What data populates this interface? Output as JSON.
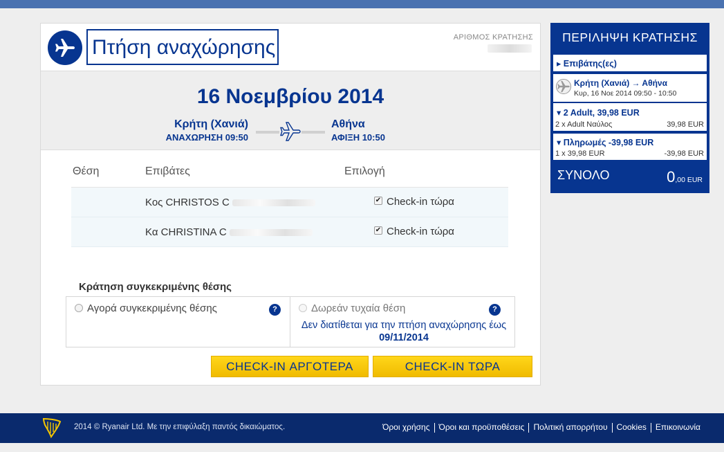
{
  "header": {
    "title": "Πτήση αναχώρησης",
    "booking_label": "ΑΡΙΘΜΟΣ ΚΡΑΤΗΣΗΣ"
  },
  "flight": {
    "date": "16 Νοεμβρίου 2014",
    "origin": {
      "name": "Κρήτη (Χανιά)",
      "time_label": "ΑΝΑΧΩΡΗΣΗ 09:50"
    },
    "destination": {
      "name": "Αθήνα",
      "time_label": "ΑΦΙΞΗ 10:50"
    }
  },
  "passengers": {
    "columns": {
      "seat": "Θέση",
      "passengers": "Επιβάτες",
      "choice": "Επιλογή"
    },
    "rows": [
      {
        "name": "Κος CHRISTOS C",
        "checked": true,
        "check_label": "Check-in τώρα"
      },
      {
        "name": "Κα CHRISTINA C",
        "checked": true,
        "check_label": "Check-in τώρα"
      }
    ]
  },
  "seat_booking": {
    "title": "Κράτηση συγκεκριμένης θέσης",
    "option_buy": "Αγορά συγκεκριμένης θέσης",
    "option_free": "Δωρεάν τυχαία θέση",
    "help": "?",
    "unavailable_note": "Δεν διατίθεται για την πτήση αναχώρησης έως",
    "unavailable_date": "09/11/2014"
  },
  "buttons": {
    "later": "CHECK-IN ΑΡΓΟΤΕΡΑ",
    "now": "CHECK-IN ΤΩΡΑ"
  },
  "summary": {
    "title": "ΠΕΡΙΛΗΨΗ ΚΡΑΤΗΣΗΣ",
    "passengers_toggle": "▸ Επιβάτης(ες)",
    "route": "Κρήτη (Χανιά) → Αθήνα",
    "route_time": "Κυρ, 16 Νοε 2014 09:50 - 10:50",
    "adults_toggle": "▾ 2 Adult, 39,98 EUR",
    "adults_detail": "2 x Adult Ναύλος",
    "adults_amount": "39,98 EUR",
    "payments_toggle": "▾ Πληρωμές -39,98 EUR",
    "payments_detail": "1 x 39,98 EUR",
    "payments_amount": "-39,98 EUR",
    "total_label": "ΣΥΝΟΛΟ",
    "total_value": "0",
    "total_decimals": ",00 EUR"
  },
  "footer": {
    "copyright": "2014 © Ryanair Ltd. Με την επιφύλαξη παντός δικαιώματος.",
    "links": [
      "Όροι χρήσης",
      "Όροι και προϋποθέσεις",
      "Πολιτική απορρήτου",
      "Cookies",
      "Επικοινωνία"
    ]
  },
  "colors": {
    "brand_blue": "#073590",
    "button_yellow": "#f5c600",
    "footer_blue": "#0a2a6d",
    "topbar_blue": "#4a72b0"
  }
}
